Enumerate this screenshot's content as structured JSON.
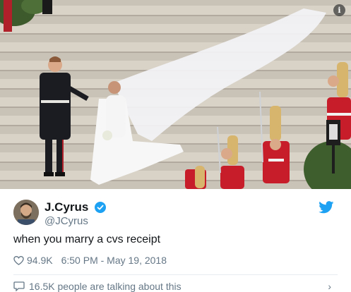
{
  "tweet": {
    "display_name": "J.Cyrus",
    "handle": "@JCyrus",
    "text": "when you marry a cvs receipt",
    "likes": "94.9K",
    "timestamp": "6:50 PM - May 19, 2018",
    "talking": "16.5K people are talking about this"
  },
  "icons": {
    "info": "info-icon",
    "verified": "verified-badge-icon",
    "bird": "twitter-bird-icon",
    "heart": "heart-icon",
    "bubble": "comment-bubble-icon",
    "chevron": "chevron-right-icon"
  },
  "colors": {
    "brand": "#1da1f2",
    "text": "#14171a",
    "muted": "#657786"
  },
  "info_glyph": "i",
  "chevron_glyph": "›"
}
